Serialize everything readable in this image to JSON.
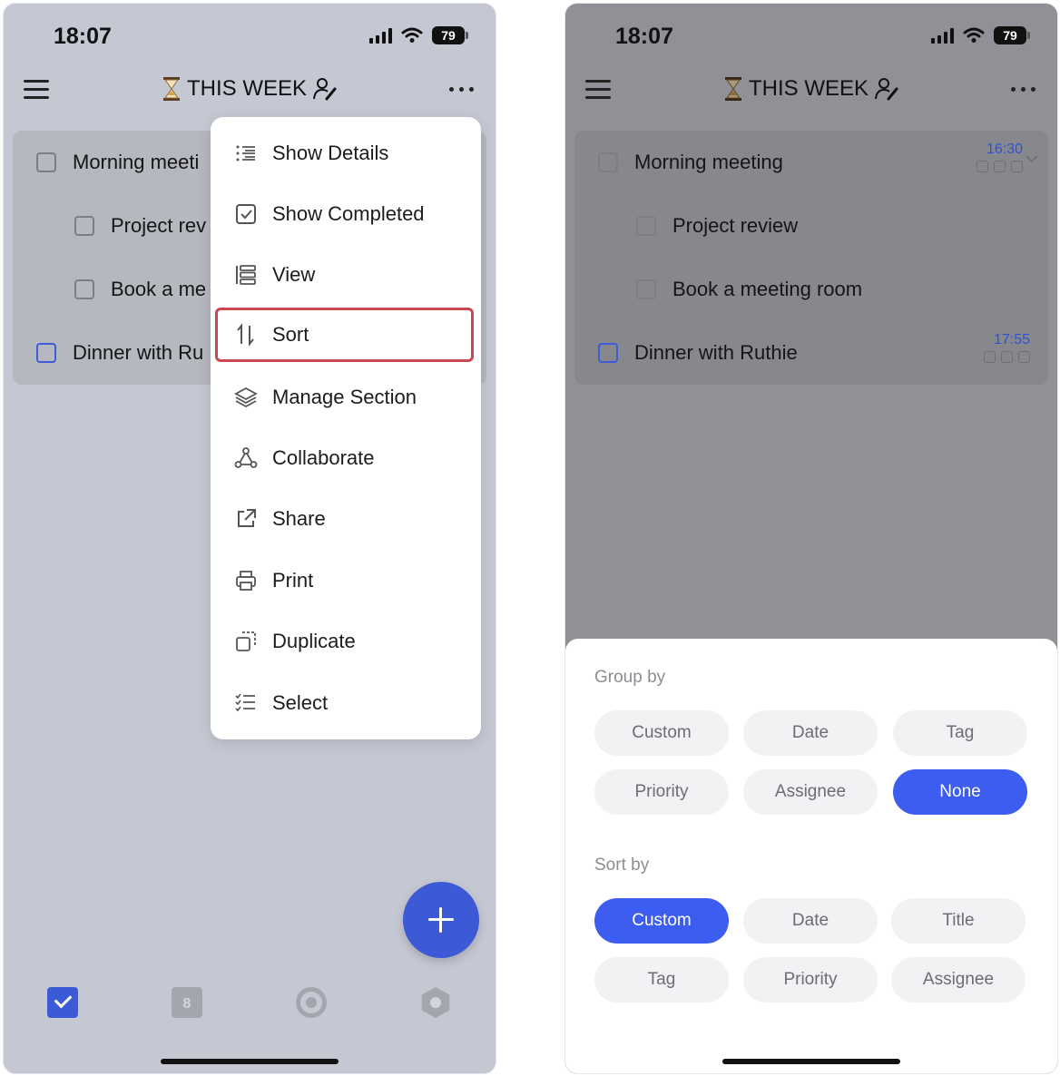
{
  "status_bar": {
    "time": "18:07",
    "battery": "79"
  },
  "header": {
    "title": "THIS WEEK"
  },
  "tasks": [
    {
      "title": "Morning meeting",
      "time": "16:30"
    },
    {
      "title": "Project review"
    },
    {
      "title": "Book a meeting room"
    },
    {
      "title": "Dinner with Ruthie",
      "time": "17:55"
    }
  ],
  "left_tasks_truncated": [
    "Morning meeti",
    "Project rev",
    "Book a me",
    "Dinner with Ru"
  ],
  "menu": {
    "items": [
      {
        "label": "Show Details",
        "icon": "list-details-icon"
      },
      {
        "label": "Show Completed",
        "icon": "check-square-icon"
      },
      {
        "label": "View",
        "icon": "view-icon"
      },
      {
        "label": "Sort",
        "icon": "sort-icon"
      },
      {
        "label": "Manage Section",
        "icon": "layers-icon"
      },
      {
        "label": "Collaborate",
        "icon": "collaborate-icon"
      },
      {
        "label": "Share",
        "icon": "share-icon"
      },
      {
        "label": "Print",
        "icon": "print-icon"
      },
      {
        "label": "Duplicate",
        "icon": "duplicate-icon"
      },
      {
        "label": "Select",
        "icon": "select-list-icon"
      }
    ],
    "highlighted": "Sort"
  },
  "tab_bar": {
    "calendar_day": "8"
  },
  "sheet": {
    "group_by": {
      "heading": "Group by",
      "options": [
        "Custom",
        "Date",
        "Tag",
        "Priority",
        "Assignee",
        "None"
      ],
      "selected": "None"
    },
    "sort_by": {
      "heading": "Sort by",
      "options": [
        "Custom",
        "Date",
        "Title",
        "Tag",
        "Priority",
        "Assignee"
      ],
      "selected": "Custom"
    }
  },
  "colors": {
    "accent": "#3d5cf0",
    "highlight_border": "#c9474f"
  }
}
